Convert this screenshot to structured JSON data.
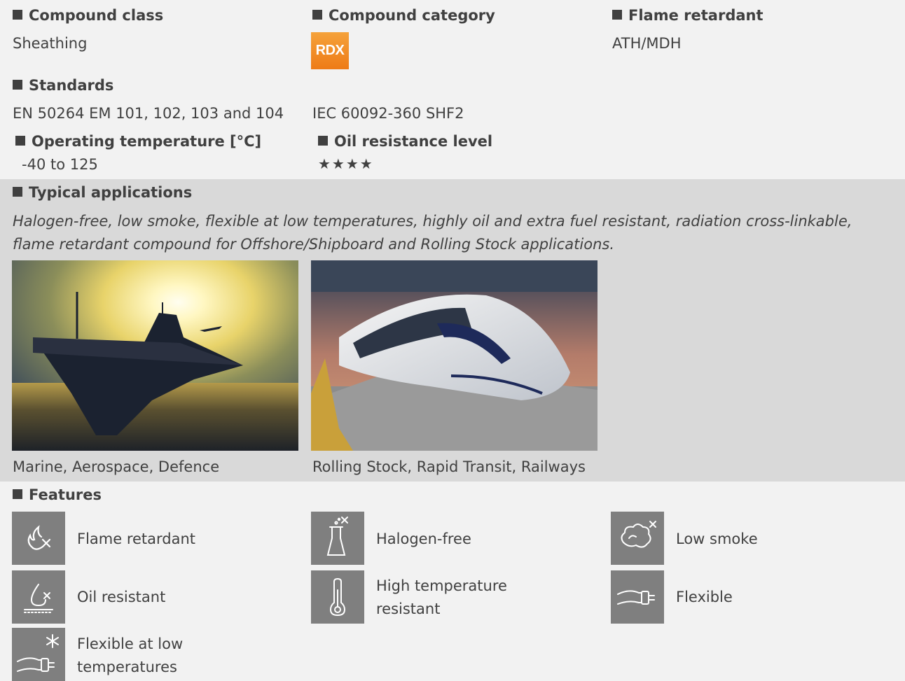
{
  "compound_class": {
    "label": "Compound class",
    "value": "Sheathing"
  },
  "compound_category": {
    "label": "Compound category",
    "badge_text": "RDX",
    "badge_color": "#ef8320"
  },
  "flame_retardant": {
    "label": "Flame retardant",
    "value": "ATH/MDH"
  },
  "standards": {
    "label": "Standards",
    "items": [
      "EN 50264 EM 101, 102, 103 and 104",
      "IEC 60092-360 SHF2"
    ]
  },
  "operating_temperature": {
    "label": "Operating temperature [°C]",
    "value": "-40 to 125"
  },
  "oil_resistance": {
    "label": "Oil resistance level",
    "stars": "★★★★"
  },
  "typical_applications": {
    "label": "Typical applications",
    "description_line1": "Halogen-free, low smoke, flexible at low temperatures, highly oil and extra fuel resistant, radiation cross-linkable,",
    "description_line2": "flame retardant compound for Offshore/Shipboard and Rolling Stock applications.",
    "images": [
      {
        "icon": "warship-sunset-photo",
        "caption": "Marine, Aerospace, Defence"
      },
      {
        "icon": "high-speed-train-photo",
        "caption": "Rolling Stock, Rapid Transit, Railways"
      }
    ]
  },
  "features": {
    "label": "Features",
    "icon_bg": "#7f7f7f",
    "items": [
      {
        "icon": "flame-retardant-icon",
        "label": "Flame retardant"
      },
      {
        "icon": "halogen-free-icon",
        "label": "Halogen-free"
      },
      {
        "icon": "low-smoke-icon",
        "label": "Low smoke"
      },
      {
        "icon": "oil-resistant-icon",
        "label": "Oil resistant"
      },
      {
        "icon": "thermometer-icon",
        "label_line1": "High temperature",
        "label_line2": "resistant"
      },
      {
        "icon": "flexible-cable-icon",
        "label": "Flexible"
      },
      {
        "icon": "snowflake-cable-icon",
        "label_line1": "Flexible at low",
        "label_line2": "temperatures"
      }
    ]
  }
}
